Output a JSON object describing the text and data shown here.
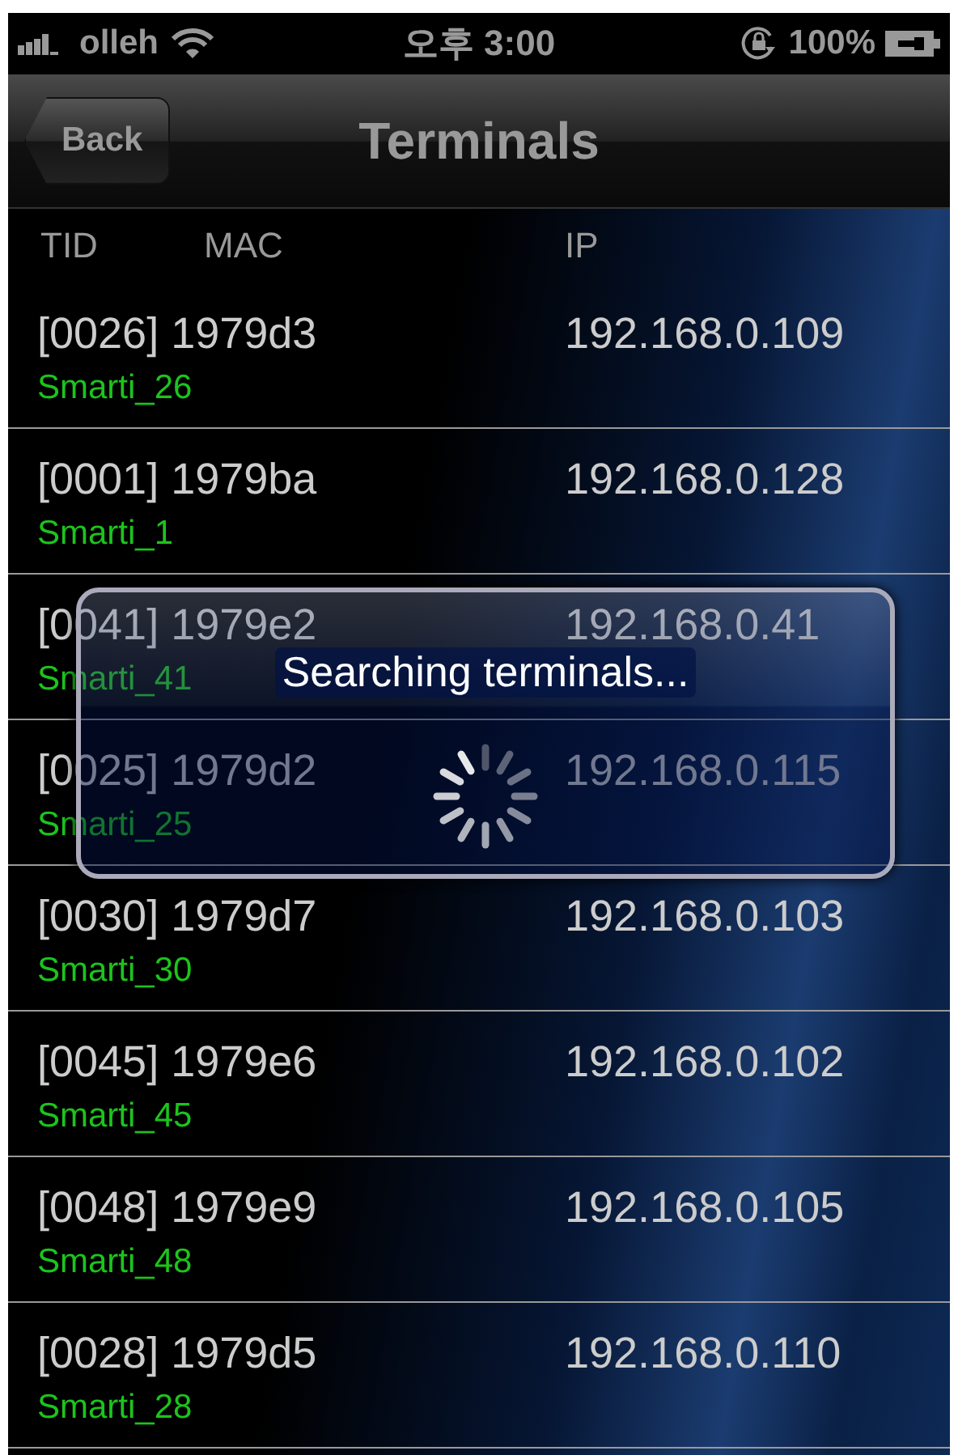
{
  "status_bar": {
    "carrier": "olleh",
    "time": "오후 3:00",
    "battery": "100%"
  },
  "nav_bar": {
    "back": "Back",
    "title": "Terminals"
  },
  "table": {
    "columns": [
      "TID",
      "MAC",
      "IP"
    ],
    "rows": [
      {
        "id": "[0026] 1979d3",
        "ip": "192.168.0.109",
        "name": "Smarti_26"
      },
      {
        "id": "[0001] 1979ba",
        "ip": "192.168.0.128",
        "name": "Smarti_1"
      },
      {
        "id": "[0041] 1979e2",
        "ip": "192.168.0.41",
        "name": "Smarti_41"
      },
      {
        "id": "[0025] 1979d2",
        "ip": "192.168.0.115",
        "name": "Smarti_25"
      },
      {
        "id": "[0030] 1979d7",
        "ip": "192.168.0.103",
        "name": "Smarti_30"
      },
      {
        "id": "[0045] 1979e6",
        "ip": "192.168.0.102",
        "name": "Smarti_45"
      },
      {
        "id": "[0048] 1979e9",
        "ip": "192.168.0.105",
        "name": "Smarti_48"
      },
      {
        "id": "[0028] 1979d5",
        "ip": "192.168.0.110",
        "name": "Smarti_28"
      }
    ]
  },
  "progress_dialog": {
    "message": "Searching terminals..."
  }
}
